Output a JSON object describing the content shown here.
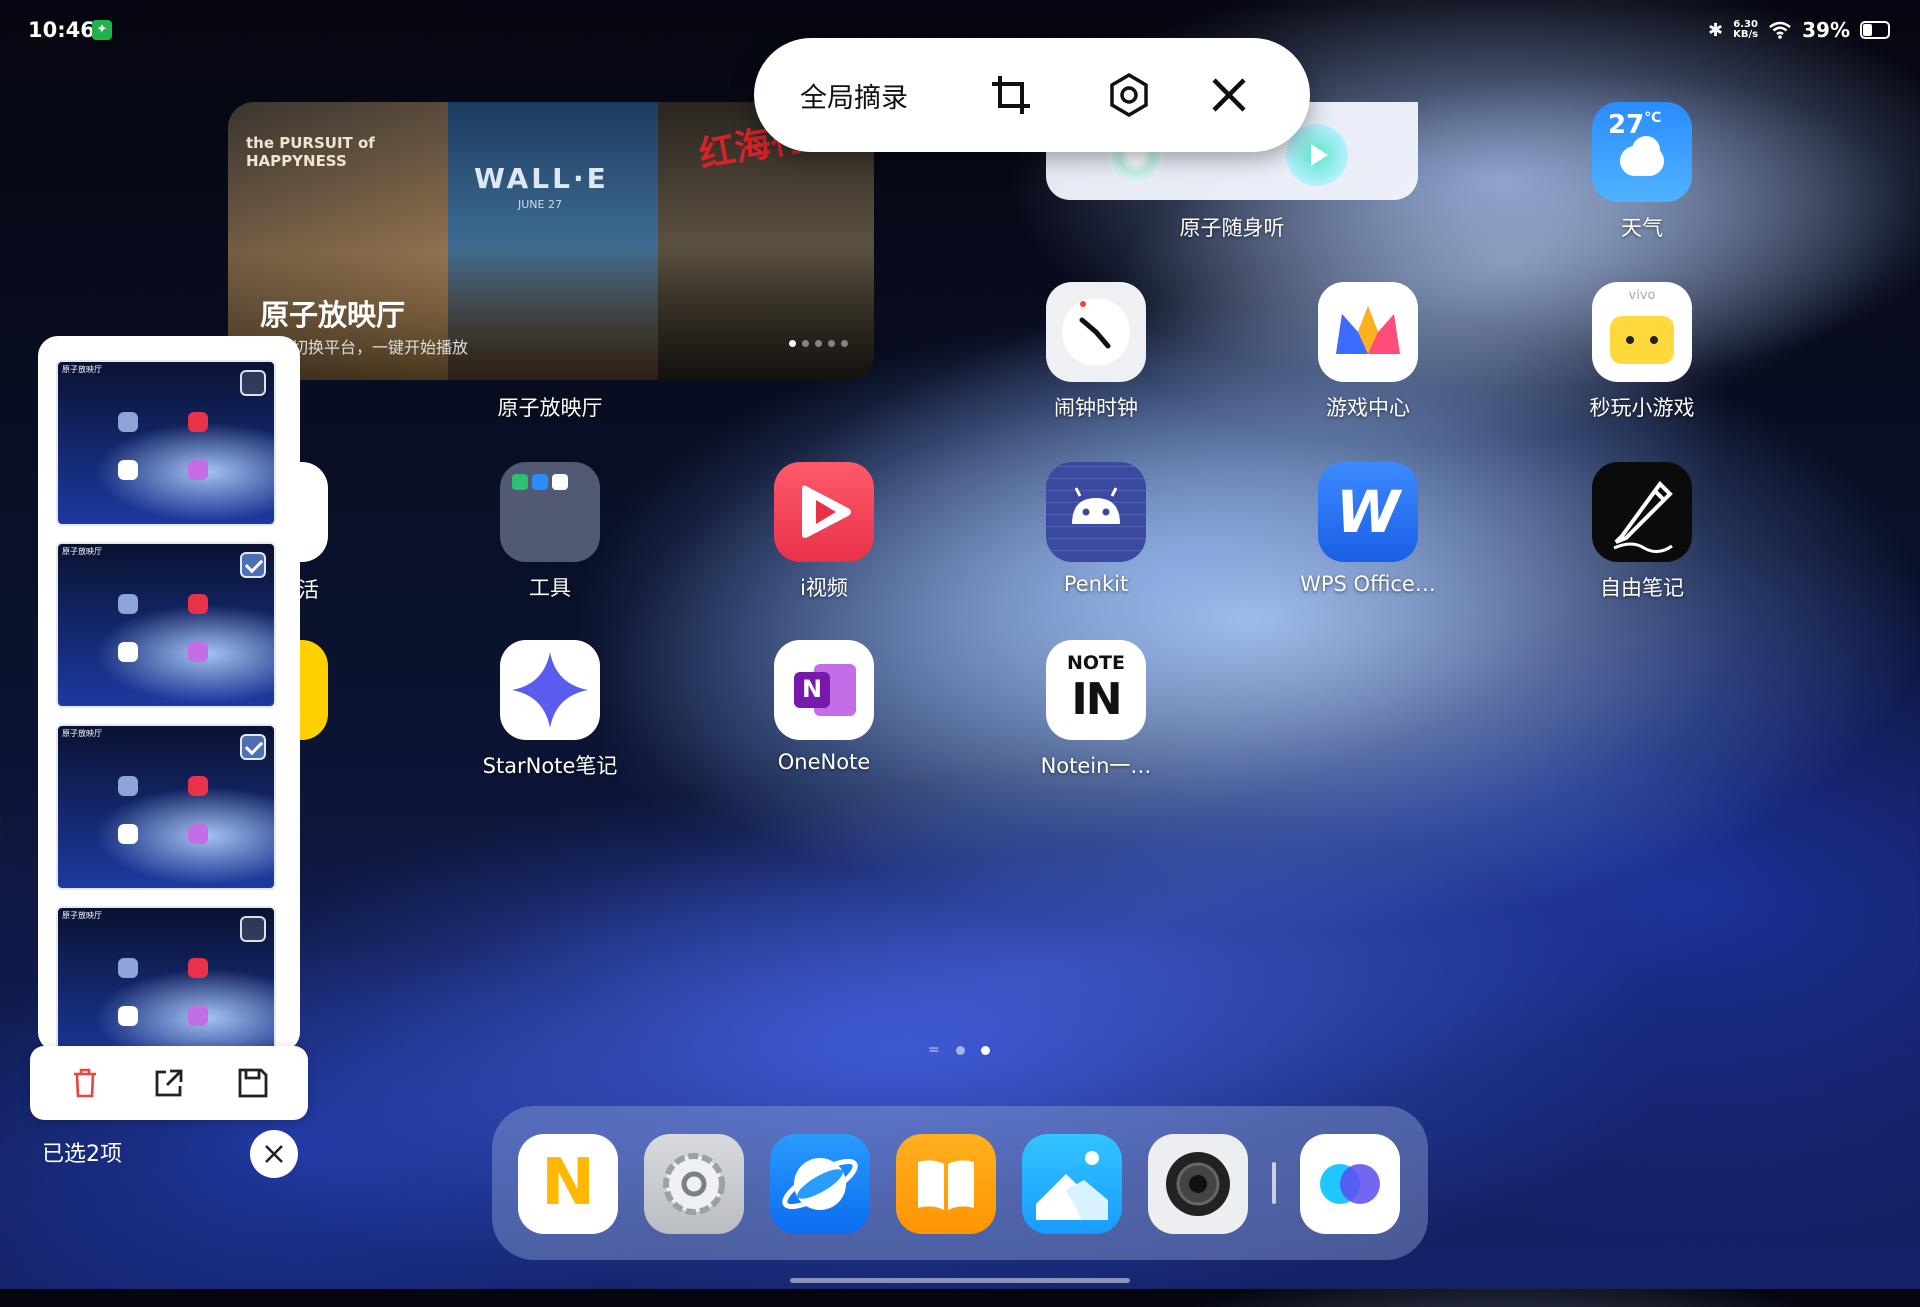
{
  "status_bar": {
    "time": "10:46",
    "net_speed_value": "6.30",
    "net_speed_unit": "KB/s",
    "battery": "39%",
    "battery_level": 0.39
  },
  "capture_toolbar": {
    "label": "全局摘录",
    "icons": [
      "crop-icon",
      "settings-icon",
      "close-icon"
    ]
  },
  "movie_widget": {
    "title": "原子放映厅",
    "subtitle": "多端切换平台，一键开始播放",
    "posters": [
      "the PURSUIT of HAPPYNESS",
      "WALL·E",
      "红海行动"
    ],
    "wall_e_logo": "WALL·E",
    "wall_e_date": "JUNE 27",
    "label": "原子放映厅"
  },
  "music_widget": {
    "label": "原子随身听"
  },
  "apps": [
    {
      "label": "天气",
      "icon": "weather-icon",
      "temp": "27",
      "unit": "℃"
    },
    {
      "label": "闹钟时钟",
      "icon": "clock-icon"
    },
    {
      "label": "游戏中心",
      "icon": "game-center-icon"
    },
    {
      "label": "秒玩小游戏",
      "icon": "mini-games-icon",
      "brand": "vivo"
    },
    {
      "label": "工具",
      "icon": "tools-folder-icon"
    },
    {
      "label": "i视频",
      "icon": "video-play-icon"
    },
    {
      "label": "Penkit",
      "icon": "android-icon"
    },
    {
      "label": "WPS Office…",
      "icon": "wps-icon",
      "glyph": "W"
    },
    {
      "label": "自由笔记",
      "icon": "pen-icon"
    },
    {
      "label": "StarNote笔记",
      "icon": "star-icon"
    },
    {
      "label": "OneNote",
      "icon": "onenote-icon",
      "glyph": "N"
    },
    {
      "label": "Notein一…",
      "icon": "notein-icon",
      "glyph": "NOTE",
      "glyph2": "IN"
    }
  ],
  "partial_left_apps": [
    {
      "label": "活"
    }
  ],
  "dock": [
    {
      "name": "notes-app",
      "icon": "n-notes-icon",
      "glyph": "N"
    },
    {
      "name": "settings-app",
      "icon": "gear-icon"
    },
    {
      "name": "browser-app",
      "icon": "browser-icon"
    },
    {
      "name": "books-app",
      "icon": "book-icon"
    },
    {
      "name": "gallery-app",
      "icon": "photo-icon"
    },
    {
      "name": "camera-app",
      "icon": "camera-icon"
    },
    {
      "name": "recent-app",
      "icon": "circles-icon"
    }
  ],
  "selection_tray": {
    "thumbnails": [
      {
        "checked": false,
        "caption": "原子放映厅"
      },
      {
        "checked": true,
        "caption": "原子放映厅"
      },
      {
        "checked": true,
        "caption": "原子放映厅"
      },
      {
        "checked": false,
        "caption": "原子放映厅"
      }
    ],
    "actions": [
      "delete-icon",
      "share-icon",
      "save-icon"
    ],
    "selected_text": "已选2项"
  },
  "colors": {
    "accent_red": "#e8453c",
    "toolbar_bg": "#ffffff"
  }
}
